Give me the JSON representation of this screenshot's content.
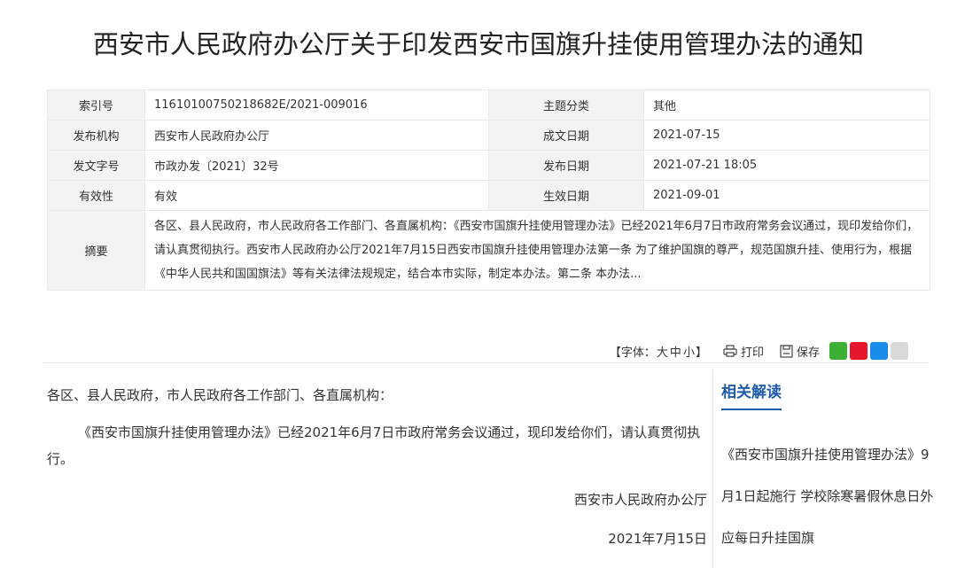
{
  "page": {
    "title": "西安市人民政府办公厅关于印发西安市国旗升挂使用管理办法的通知"
  },
  "meta": {
    "rows": [
      {
        "k1": "索引号",
        "v1": "11610100750218682E/2021-009016",
        "k2": "主题分类",
        "v2": "其他"
      },
      {
        "k1": "发布机构",
        "v1": "西安市人民政府办公厅",
        "k2": "成文日期",
        "v2": "2021-07-15"
      },
      {
        "k1": "发文字号",
        "v1": "市政办发〔2021〕32号",
        "k2": "发布日期",
        "v2": "2021-07-21 18:05"
      },
      {
        "k1": "有效性",
        "v1": "有效",
        "k2": "生效日期",
        "v2": "2021-09-01"
      }
    ],
    "abstract_label": "摘要",
    "abstract_text": "各区、县人民政府，市人民政府各工作部门、各直属机构：《西安市国旗升挂使用管理办法》已经2021年6月7日市政府常务会议通过，现印发给你们，请认真贯彻执行。西安市人民政府办公厅2021年7月15日西安市国旗升挂使用管理办法第一条 为了维护国旗的尊严，规范国旗升挂、使用行为，根据《中华人民共和国国旗法》等有关法律法规规定，结合本市实际，制定本办法。第二条 本办法..."
  },
  "toolbar": {
    "font_prefix": "【字体：",
    "font_large": "大",
    "font_medium": "中",
    "font_small": "小",
    "font_suffix": "】",
    "print_label": "打印",
    "save_label": "保存",
    "share_colors": {
      "wechat": "#3cb034",
      "weibo": "#e6162d",
      "qq": "#1a8be9",
      "copy": "#d9d9d9"
    }
  },
  "content": {
    "greeting": "各区、县人民政府，市人民政府各工作部门、各直属机构：",
    "paragraph": "《西安市国旗升挂使用管理办法》已经2021年6月7日市政府常务会议通过，现印发给你们，请认真贯彻执行。",
    "signature": "西安市人民政府办公厅",
    "date": "2021年7月15日"
  },
  "sidebar": {
    "title": "相关解读",
    "link": "《西安市国旗升挂使用管理办法》9月1日起施行 学校除寒暑假休息日外应每日升挂国旗",
    "accent": "#1e5aa7"
  }
}
